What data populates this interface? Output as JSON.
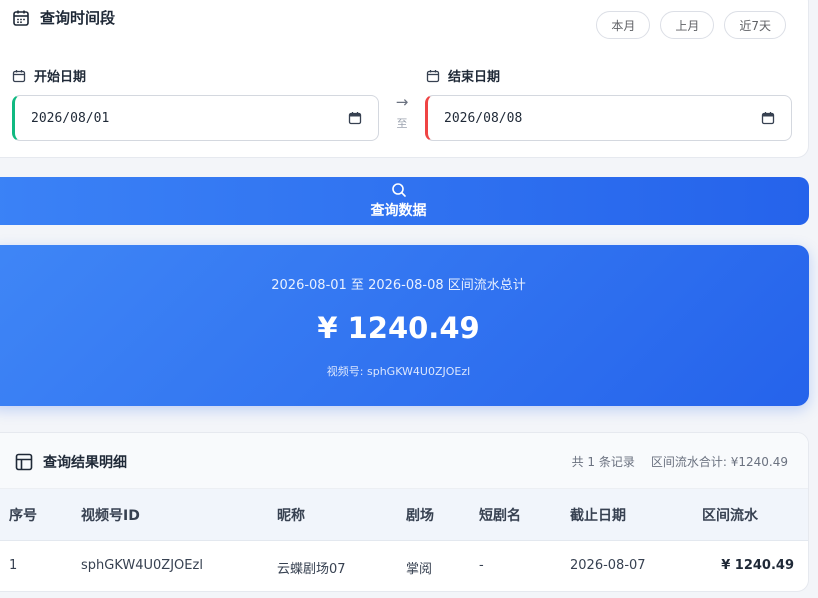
{
  "range": {
    "title": "查询时间段",
    "quick": [
      "本月",
      "上月",
      "近7天"
    ],
    "start_label": "开始日期",
    "start_value": "2026/08/01",
    "end_label": "结束日期",
    "end_value": "2026/08/08",
    "separator": "至"
  },
  "search": {
    "label": "查询数据"
  },
  "summary": {
    "range_text": "2026-08-01 至 2026-08-08 区间流水总计",
    "amount": "¥ 1240.49",
    "account": "视频号: sphGKW4U0ZJOEzl"
  },
  "result": {
    "title": "查询结果明细",
    "record_count": "共 1 条记录",
    "total": "区间流水合计: ¥1240.49",
    "columns": [
      "序号",
      "视频号ID",
      "昵称",
      "剧场",
      "短剧名",
      "截止日期",
      "区间流水"
    ],
    "rows": [
      [
        "1",
        "sphGKW4U0ZJOEzl",
        "云蝶剧场07",
        "掌阅",
        "-",
        "2026-08-07",
        "¥ 1240.49"
      ]
    ]
  },
  "colors": {
    "accent": "#2563eb",
    "start": "#10b981",
    "end": "#ef4444"
  }
}
